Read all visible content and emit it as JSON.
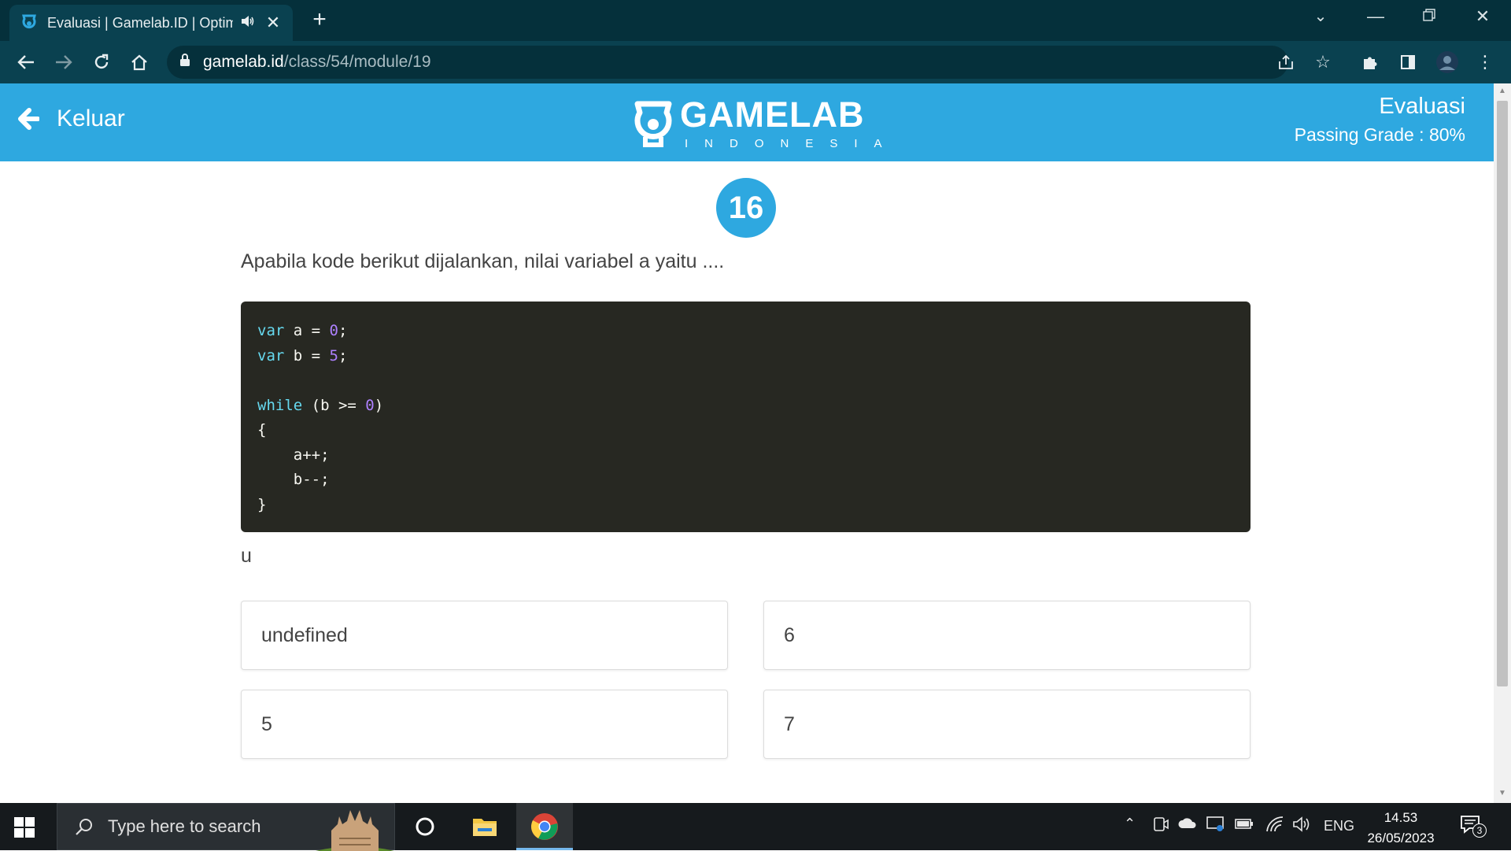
{
  "browser": {
    "tab": {
      "title": "Evaluasi | Gamelab.ID | Optim",
      "audio_icon": "speaker-icon"
    },
    "address": {
      "host": "gamelab.id",
      "path": "/class/54/module/19"
    },
    "colors": {
      "frame": "#05303b",
      "toolbar": "#0a4150"
    }
  },
  "header": {
    "back_label": "Keluar",
    "logo_text": "GAMELAB",
    "logo_sub": "INDONESIA",
    "title": "Evaluasi",
    "passing_grade": "Passing Grade : 80%",
    "color": "#2ea8e0"
  },
  "question": {
    "number": "16",
    "text": "Apabila kode berikut dijalankan, nilai variabel a yaitu ....",
    "code_lines": [
      [
        {
          "t": "var",
          "c": "kw"
        },
        {
          "t": " a = "
        },
        {
          "t": "0",
          "c": "num"
        },
        {
          "t": ";"
        }
      ],
      [
        {
          "t": "var",
          "c": "kw"
        },
        {
          "t": " b = "
        },
        {
          "t": "5",
          "c": "num"
        },
        {
          "t": ";"
        }
      ],
      [],
      [
        {
          "t": "while",
          "c": "kw"
        },
        {
          "t": " (b >= "
        },
        {
          "t": "0",
          "c": "num"
        },
        {
          "t": ")"
        }
      ],
      [
        {
          "t": "{"
        }
      ],
      [
        {
          "t": "    a++;"
        }
      ],
      [
        {
          "t": "    b--;"
        }
      ],
      [
        {
          "t": "}"
        }
      ]
    ],
    "extra_text": "u"
  },
  "options": [
    {
      "label": "undefined"
    },
    {
      "label": "6"
    },
    {
      "label": "5"
    },
    {
      "label": "7"
    }
  ],
  "taskbar": {
    "search_placeholder": "Type here to search",
    "language": "ENG",
    "time": "14.53",
    "date": "26/05/2023",
    "notification_count": "3"
  }
}
